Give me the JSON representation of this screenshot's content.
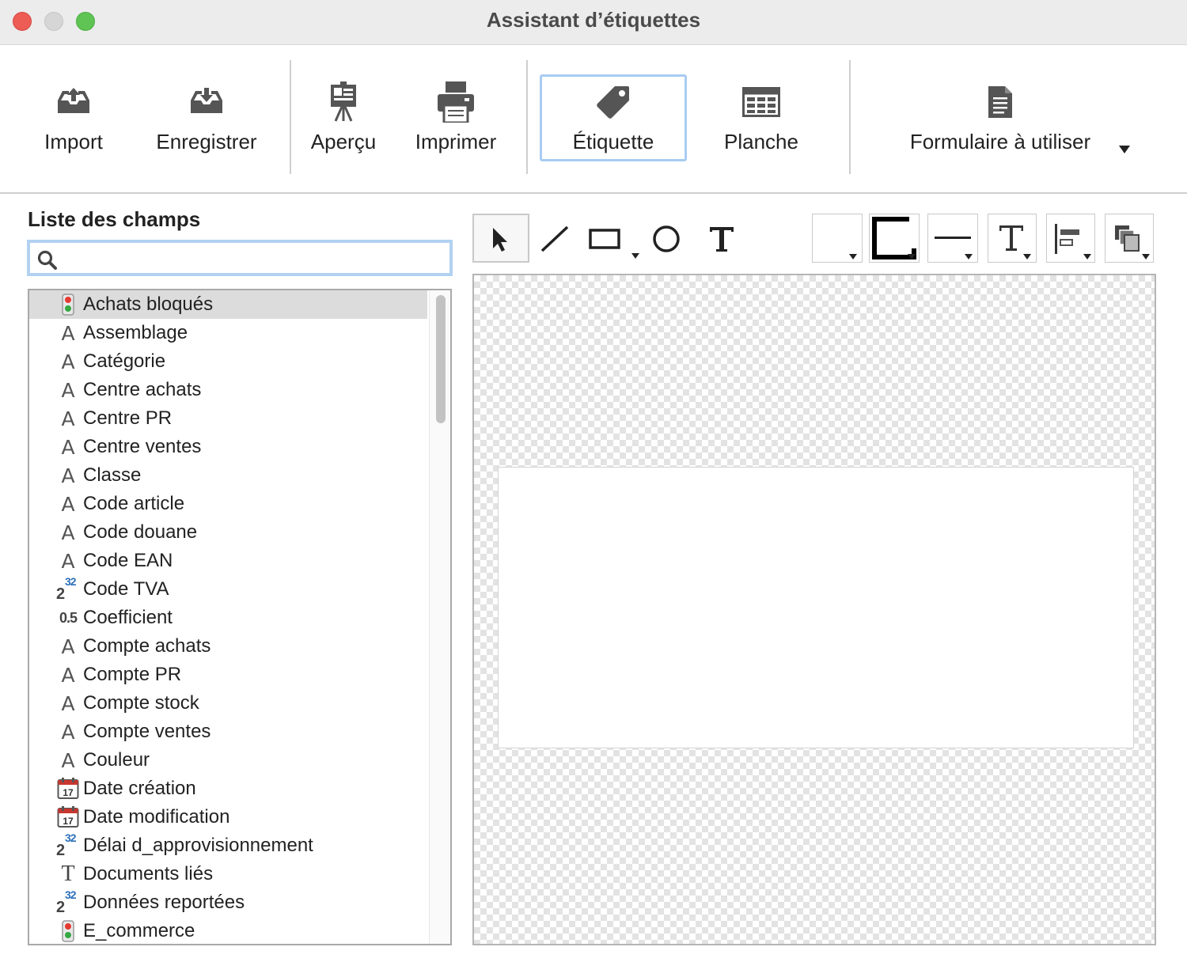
{
  "window": {
    "title": "Assistant d’étiquettes"
  },
  "toolbar": {
    "import": "Import",
    "save": "Enregistrer",
    "preview": "Aperçu",
    "print": "Imprimer",
    "label": "Étiquette",
    "sheet": "Planche",
    "form": "Formulaire à utiliser"
  },
  "fields_panel": {
    "title": "Liste des champs",
    "search_value": "",
    "items": [
      {
        "label": "Achats bloqués",
        "icon": "traffic-light-icon"
      },
      {
        "label": "Assemblage",
        "icon": "text-field-icon"
      },
      {
        "label": "Catégorie",
        "icon": "text-field-icon"
      },
      {
        "label": "Centre achats",
        "icon": "text-field-icon"
      },
      {
        "label": "Centre PR",
        "icon": "text-field-icon"
      },
      {
        "label": "Centre ventes",
        "icon": "text-field-icon"
      },
      {
        "label": "Classe",
        "icon": "text-field-icon"
      },
      {
        "label": "Code article",
        "icon": "text-field-icon"
      },
      {
        "label": "Code douane",
        "icon": "text-field-icon"
      },
      {
        "label": "Code EAN",
        "icon": "text-field-icon"
      },
      {
        "label": "Code TVA",
        "icon": "integer-field-icon"
      },
      {
        "label": "Coefficient",
        "icon": "real-field-icon"
      },
      {
        "label": "Compte achats",
        "icon": "text-field-icon"
      },
      {
        "label": "Compte PR",
        "icon": "text-field-icon"
      },
      {
        "label": "Compte stock",
        "icon": "text-field-icon"
      },
      {
        "label": "Compte ventes",
        "icon": "text-field-icon"
      },
      {
        "label": "Couleur",
        "icon": "text-field-icon"
      },
      {
        "label": "Date création",
        "icon": "calendar-icon"
      },
      {
        "label": "Date modification",
        "icon": "calendar-icon"
      },
      {
        "label": "Délai d_approvisionnement",
        "icon": "integer-field-icon"
      },
      {
        "label": "Documents liés",
        "icon": "long-text-icon"
      },
      {
        "label": "Données reportées",
        "icon": "integer-field-icon"
      },
      {
        "label": "E_commerce",
        "icon": "traffic-light-icon"
      }
    ],
    "selected_index": 0
  },
  "icon_glyphs": {
    "text": "A",
    "long_text": "T",
    "int_base": "2",
    "int_exp": "32",
    "real": "0.5",
    "calendar_day": "17"
  },
  "colors": {
    "selection_border": "#a8ccf2",
    "list_selection": "#dcdcdc",
    "close": "#ee5c56",
    "maximize": "#5fc454"
  }
}
